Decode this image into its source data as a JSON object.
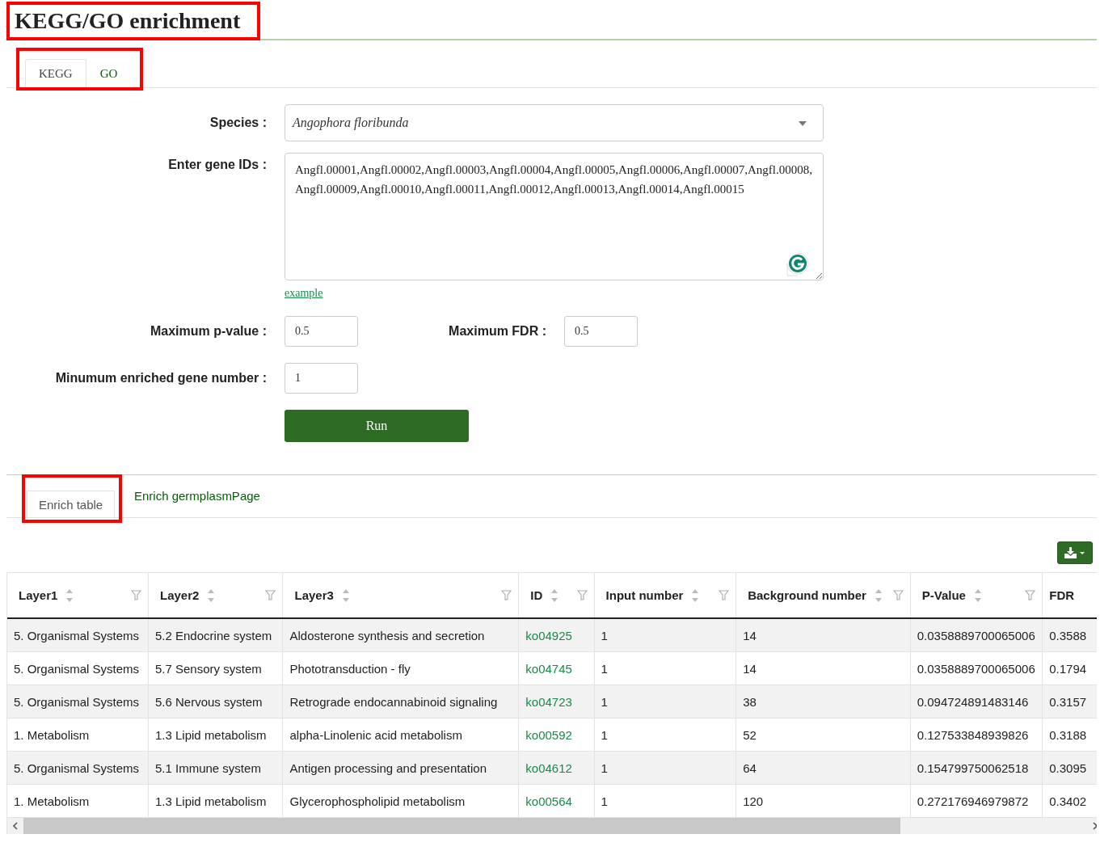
{
  "title": "KEGG/GO enrichment",
  "tabs": [
    {
      "label": "KEGG",
      "selected": true
    },
    {
      "label": "GO",
      "selected": false
    }
  ],
  "form": {
    "species_label": "Species :",
    "species_value": "Angophora floribunda",
    "genes_label": "Enter gene IDs :",
    "genes_value": "Angfl.00001,Angfl.00002,Angfl.00003,Angfl.00004,Angfl.00005,Angfl.00006,Angfl.00007,Angfl.00008,Angfl.00009,Angfl.00010,Angfl.00011,Angfl.00012,Angfl.00013,Angfl.00014,Angfl.00015",
    "example_link": "example",
    "pvalue_label": "Maximum p-value :",
    "pvalue_value": "0.5",
    "fdr_label": "Maximum FDR :",
    "fdr_value": "0.5",
    "min_label": "Minumum enriched gene number :",
    "min_value": "1",
    "run_button": "Run"
  },
  "result_tabs": [
    {
      "label": "Enrich table",
      "selected": true
    },
    {
      "label": "Enrich germplasmPage",
      "selected": false
    }
  ],
  "table": {
    "columns": [
      {
        "label": "Layer1",
        "kind": "text",
        "sortable": true
      },
      {
        "label": "Layer2",
        "kind": "text",
        "sortable": true
      },
      {
        "label": "Layer3",
        "kind": "text",
        "sortable": true
      },
      {
        "label": "ID",
        "kind": "link",
        "sortable": true
      },
      {
        "label": "Input number",
        "kind": "text",
        "sortable": true
      },
      {
        "label": "Background number",
        "kind": "text",
        "sortable": true
      },
      {
        "label": "P-Value",
        "kind": "text",
        "sortable": true
      },
      {
        "label": "FDR",
        "kind": "text",
        "sortable": false
      }
    ],
    "rows": [
      [
        "5. Organismal Systems",
        "5.2 Endocrine system",
        "Aldosterone synthesis and secretion",
        "ko04925",
        "1",
        "14",
        "0.0358889700065006",
        "0.3588"
      ],
      [
        "5. Organismal Systems",
        "5.7 Sensory system",
        "Phototransduction - fly",
        "ko04745",
        "1",
        "14",
        "0.0358889700065006",
        "0.1794"
      ],
      [
        "5. Organismal Systems",
        "5.6 Nervous system",
        "Retrograde endocannabinoid signaling",
        "ko04723",
        "1",
        "38",
        "0.094724891483146",
        "0.3157"
      ],
      [
        "1. Metabolism",
        "1.3 Lipid metabolism",
        "alpha-Linolenic acid metabolism",
        "ko00592",
        "1",
        "52",
        "0.127533848939826",
        "0.3188"
      ],
      [
        "5. Organismal Systems",
        "5.1 Immune system",
        "Antigen processing and presentation",
        "ko04612",
        "1",
        "64",
        "0.154799750062518",
        "0.3095"
      ],
      [
        "1. Metabolism",
        "1.3 Lipid metabolism",
        "Glycerophospholipid metabolism",
        "ko00564",
        "1",
        "120",
        "0.272176946979872",
        "0.3402"
      ]
    ]
  }
}
